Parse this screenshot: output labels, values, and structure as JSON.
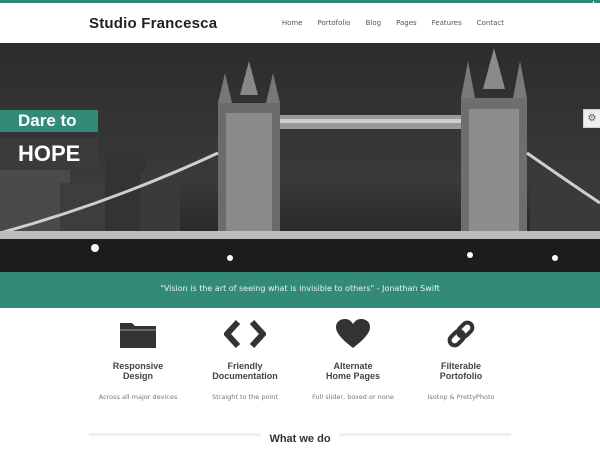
{
  "site": {
    "logo": "Studio Francesca"
  },
  "nav": {
    "items": [
      "Home",
      "Portofolio",
      "Blog",
      "Pages",
      "Features",
      "Contact"
    ]
  },
  "hero": {
    "line1": "Dare to",
    "line2": "HOPE"
  },
  "quote": {
    "text": "\"Vision is the art of seeing what is invisible to others\" - Jonathan Swift"
  },
  "features": [
    {
      "title": "Responsive\nDesign",
      "subtitle": "Across all major devices",
      "icon": "folder-icon"
    },
    {
      "title": "Friendly\nDocumentation",
      "subtitle": "Straight to the point",
      "icon": "code-icon"
    },
    {
      "title": "Alternate\nHome Pages",
      "subtitle": "Full slider, boxed or none",
      "icon": "heart-icon"
    },
    {
      "title": "Filterable\nPortofolio",
      "subtitle": "Isotop & PrettyPhoto",
      "icon": "link-icon"
    }
  ],
  "section": {
    "title": "What we do"
  },
  "colors": {
    "accent": "#338a79",
    "dark_label": "#3b3b3b"
  }
}
